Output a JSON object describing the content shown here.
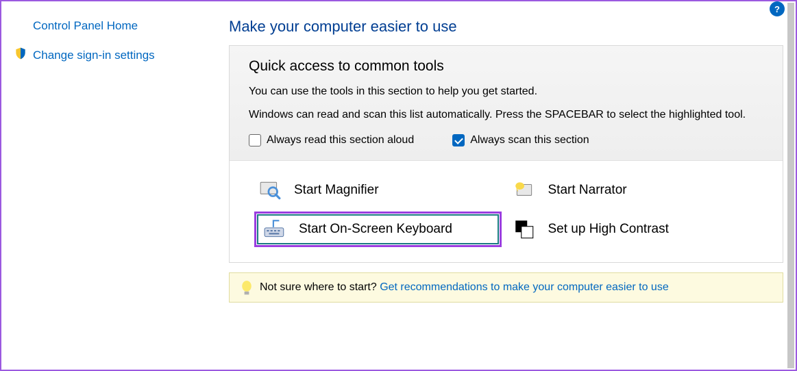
{
  "sidebar": {
    "home_label": "Control Panel Home",
    "signin_label": "Change sign-in settings"
  },
  "page": {
    "title": "Make your computer easier to use"
  },
  "quick_access": {
    "heading": "Quick access to common tools",
    "desc1": "You can use the tools in this section to help you get started.",
    "desc2": "Windows can read and scan this list automatically.  Press the SPACEBAR to select the highlighted tool.",
    "check_read_label": "Always read this section aloud",
    "check_read_checked": false,
    "check_scan_label": "Always scan this section",
    "check_scan_checked": true
  },
  "tools": {
    "magnifier": "Start Magnifier",
    "narrator": "Start Narrator",
    "osk": "Start On-Screen Keyboard",
    "high_contrast": "Set up High Contrast"
  },
  "footer": {
    "prompt": "Not sure where to start? ",
    "link": "Get recommendations to make your computer easier to use"
  }
}
